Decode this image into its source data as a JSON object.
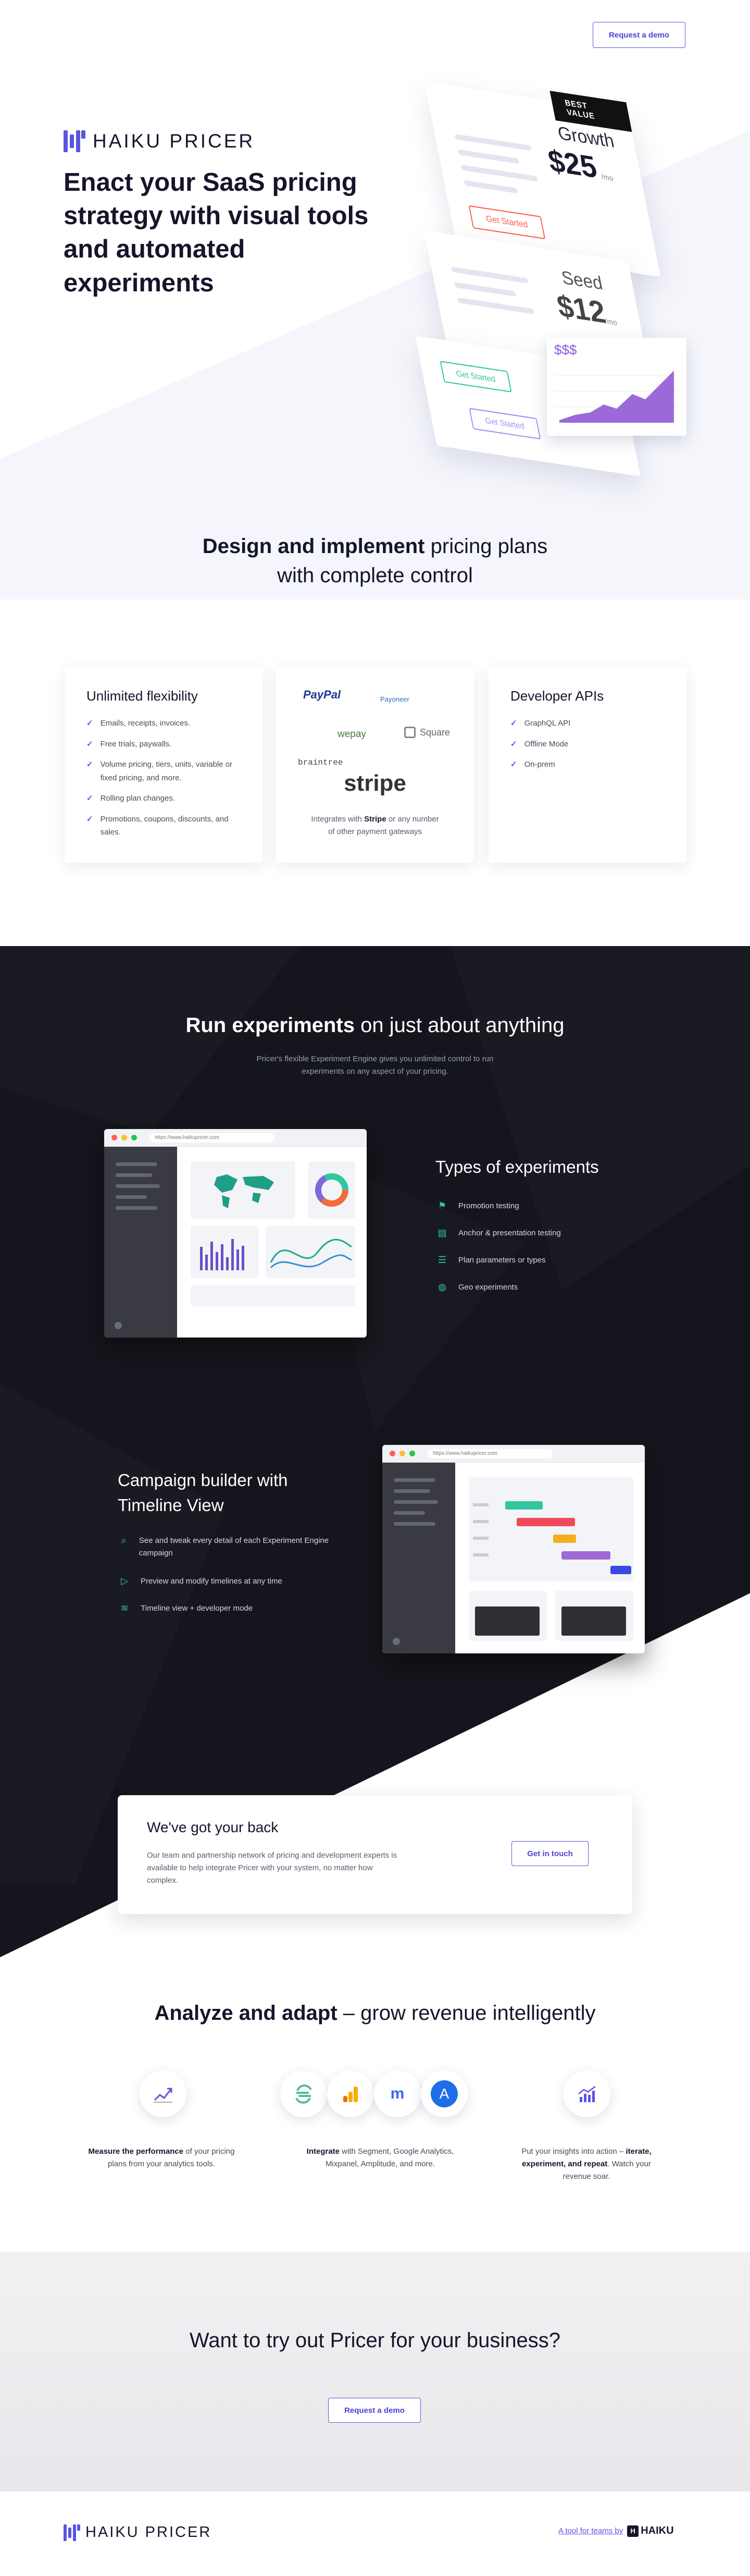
{
  "header": {
    "demo_button": "Request a demo"
  },
  "brand": {
    "name": "HAIKU PRICER",
    "footer_name": "HAIKU PRICER"
  },
  "hero": {
    "title": "Enact your SaaS pricing strategy with visual tools and automated experiments",
    "card_growth": {
      "badge": "BEST VALUE",
      "name": "Growth",
      "price": "$25",
      "period": "/mo",
      "cta": "Get Started"
    },
    "card_seed": {
      "name": "Seed",
      "price": "$12",
      "period": "/mo"
    },
    "card_buttons": [
      "Get Started",
      "Get Started"
    ],
    "revenue_label": "$$$"
  },
  "design": {
    "title_bold": "Design and implement",
    "title_rest": "pricing plans",
    "title_line2": "with complete control"
  },
  "features": {
    "flex": {
      "title": "Unlimited flexibility",
      "items": [
        "Emails, receipts, invoices.",
        "Free trials, paywalls.",
        "Volume pricing, tiers, units, variable or fixed pricing, and more.",
        "Rolling plan changes.",
        "Promotions, coupons, discounts, and sales."
      ]
    },
    "gateways": {
      "logos": [
        "PayPal",
        "Payoneer",
        "wepay",
        "Square",
        "braintree",
        "stripe"
      ],
      "text_before": "Integrates with",
      "text_bold": "Stripe",
      "text_after": "or any number of other payment gateways"
    },
    "dev": {
      "title": "Developer APIs",
      "items": [
        "GraphQL API",
        "Offline Mode",
        "On-prem"
      ]
    }
  },
  "experiments": {
    "title_bold": "Run experiments",
    "title_rest": "on just about anything",
    "subtitle": "Pricer's flexible Experiment Engine gives you unlimited control to run experiments on any aspect of your pricing.",
    "url": "https://www.haikupricer.com",
    "types_title": "Types of experiments",
    "types": [
      "Promotion testing",
      "Anchor & presentation testing",
      "Plan parameters or types",
      "Geo experiments"
    ],
    "campaign_title": "Campaign builder with Timeline View",
    "campaign_items": [
      "See and tweak every detail of each Experiment Engine campaign",
      "Preview and modify timelines at any time",
      "Timeline view + developer mode"
    ]
  },
  "support": {
    "title": "We've got your back",
    "text": "Our team and partnership network of pricing and development experts is available to help integrate Pricer with your system, no matter how complex.",
    "button": "Get in touch"
  },
  "analyze": {
    "title_bold": "Analyze and adapt",
    "title_rest": "– grow revenue intelligently",
    "col1_bold": "Measure the performance",
    "col1_rest": "of your pricing plans from your analytics tools.",
    "col2_bold": "Integrate",
    "col2_rest": "with Segment, Google Analytics, Mixpanel, Amplitude, and more.",
    "col3_before": "Put your insights into action –",
    "col3_bold": "iterate, experiment, and repeat",
    "col3_after": ". Watch your revenue soar."
  },
  "cta": {
    "title": "Want to try out Pricer for your business?",
    "button": "Request a demo"
  },
  "footer": {
    "link": "A tool for teams by",
    "haiku": "HAIKU"
  },
  "colors": {
    "accent": "#5b54e0",
    "teal": "#2fc6a0",
    "dark": "#15161d"
  }
}
